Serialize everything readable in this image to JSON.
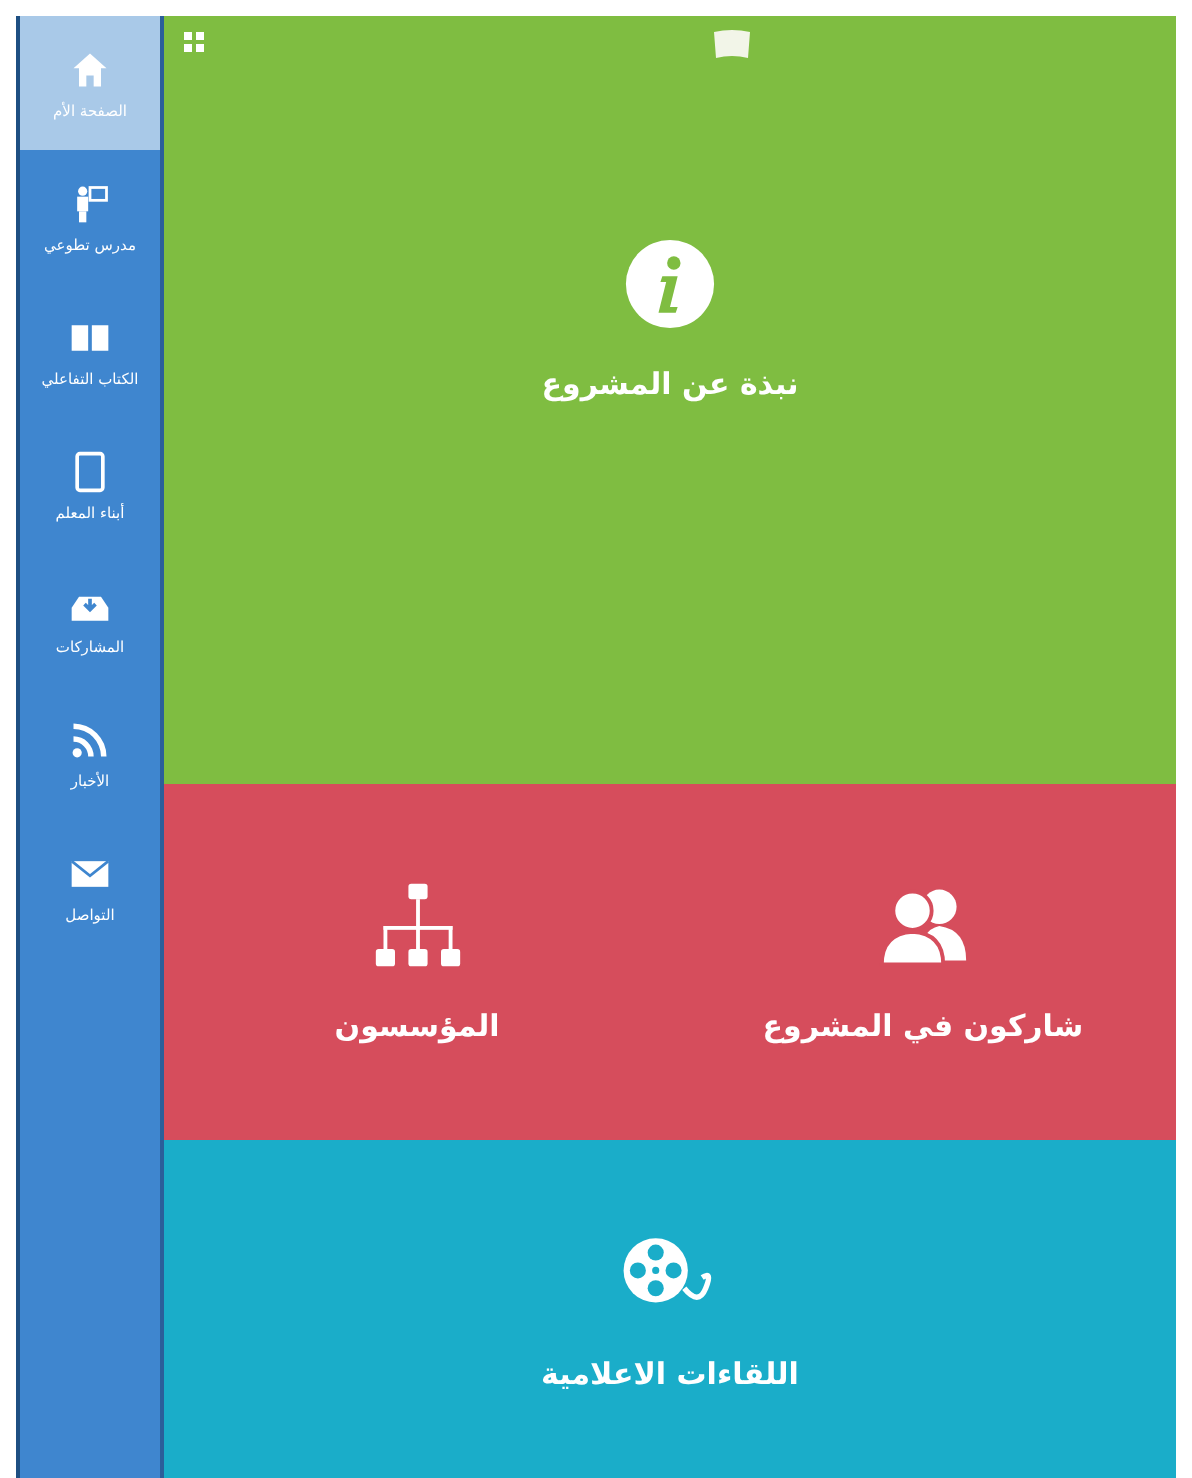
{
  "sidebar": {
    "items": [
      {
        "label": "الصفحة الأم",
        "kind": "home",
        "selected": true
      },
      {
        "label": "مدرس تطوعي",
        "kind": "teacher",
        "selected": false
      },
      {
        "label": "الكتاب التفاعلي",
        "kind": "book",
        "selected": false
      },
      {
        "label": "أبناء المعلم",
        "kind": "tablet",
        "selected": false
      },
      {
        "label": "المشاركات",
        "kind": "inbox",
        "selected": false
      },
      {
        "label": "الأخبار",
        "kind": "rss",
        "selected": false
      },
      {
        "label": "التواصل",
        "kind": "mail",
        "selected": false
      }
    ]
  },
  "tiles": [
    {
      "label": "نبذة عن المشروع",
      "color": "#7fbd41"
    },
    {
      "label": "المؤسسون",
      "color": "#d64d5c"
    },
    {
      "label": "شاركون في المشروع",
      "color": "#d64d5c"
    },
    {
      "label": "اللقاءات الاعلامية",
      "color": "#1aadc9"
    }
  ]
}
